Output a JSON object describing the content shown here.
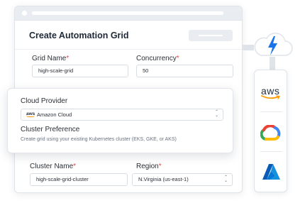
{
  "window": {
    "title": "Create Automation Grid"
  },
  "form": {
    "grid_name": {
      "label": "Grid Name",
      "required_mark": "*",
      "value": "high-scale-grid"
    },
    "concurrency": {
      "label": "Concurrency",
      "required_mark": "*",
      "value": "50"
    },
    "cluster_name": {
      "label": "Cluster Name",
      "required_mark": "*",
      "value": "high-scale-grid-cluster"
    },
    "region": {
      "label": "Region",
      "required_mark": "*",
      "value": "N.Virginia (us-east-1)"
    }
  },
  "provider_card": {
    "cloud_provider_label": "Cloud Provider",
    "cloud_provider_value": "Amazon Cloud",
    "cloud_provider_icon_text": "aws",
    "cluster_preference_label": "Cluster Preference",
    "cluster_preference_desc": "Create grid using  your existing Kubernetes cluster (EKS, GKE, or AKS)"
  },
  "providers": [
    {
      "name": "aws",
      "icon": "aws-logo-icon",
      "logo_text": "aws"
    },
    {
      "name": "gcp",
      "icon": "google-cloud-icon"
    },
    {
      "name": "azure",
      "icon": "azure-icon"
    }
  ],
  "colors": {
    "required": "#e5484d",
    "cloud_blue": "#1a73e8",
    "aws_orange": "#ff9900",
    "azure_blue": "#0078d4"
  }
}
